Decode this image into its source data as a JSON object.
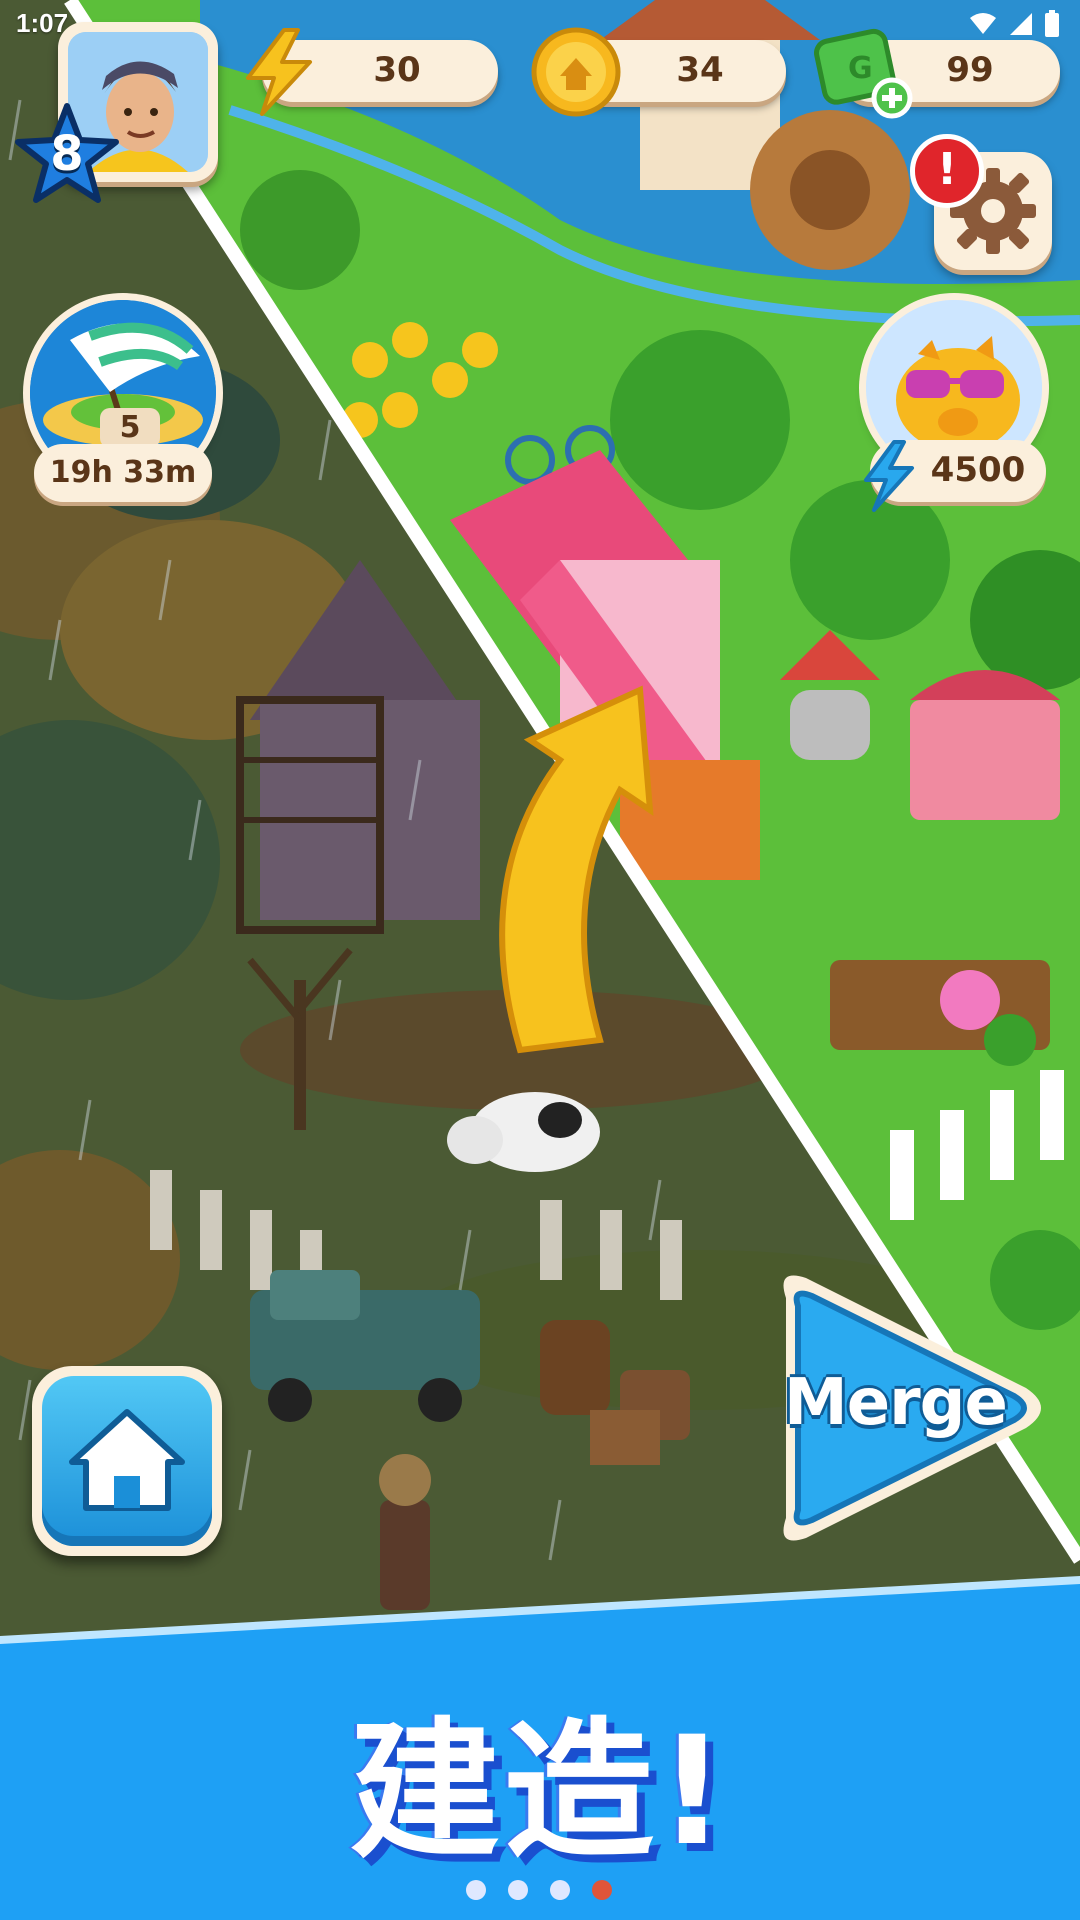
{
  "status_bar": {
    "time": "1:07"
  },
  "hud": {
    "player_level": "8",
    "energy": "30",
    "coins": "34",
    "gems": "99",
    "event_count": "5",
    "event_timer": "19h 33m",
    "piggy_bank_energy": "4500",
    "settings_alert": "!"
  },
  "buttons": {
    "merge_label": "Merge"
  },
  "banner": {
    "title": "建造!",
    "page_count": 4,
    "active_page": 4
  },
  "colors": {
    "banner_blue": "#1ea0f5",
    "pill_cream": "#fbefdc",
    "value_brown": "#5a3518",
    "active_dot": "#e0553a"
  }
}
